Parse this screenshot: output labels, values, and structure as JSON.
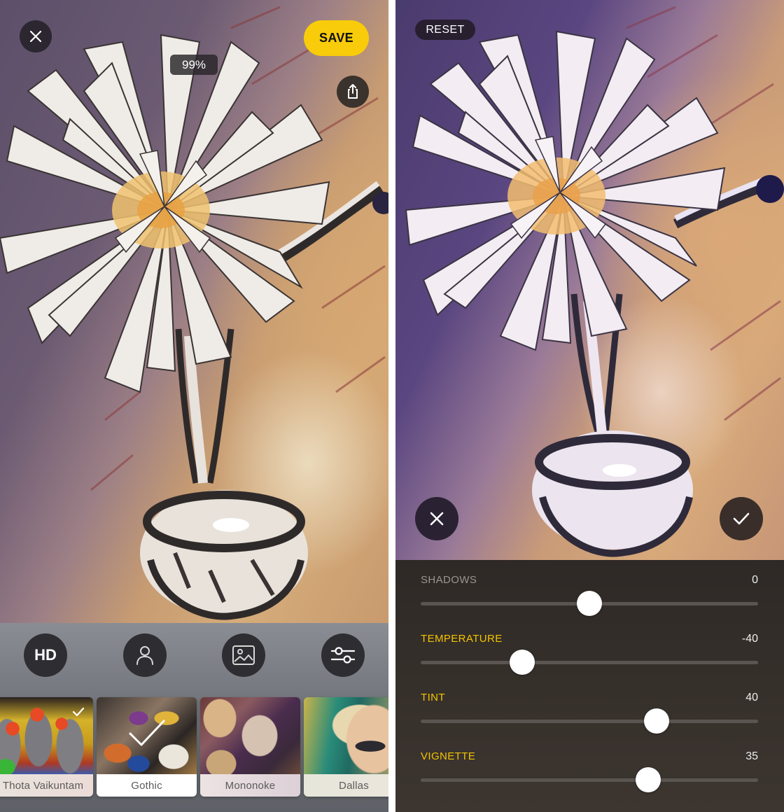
{
  "left_screen": {
    "top_bar": {
      "close_icon": "close-icon",
      "save_label": "SAVE",
      "progress_label": "99%",
      "progress_percent": 99,
      "share_icon": "share-icon"
    },
    "tools": [
      {
        "id": "hd",
        "label": "HD",
        "icon": "hd-text"
      },
      {
        "id": "portrait",
        "label": "",
        "icon": "person-icon"
      },
      {
        "id": "background",
        "label": "",
        "icon": "image-icon"
      },
      {
        "id": "adjust",
        "label": "",
        "icon": "sliders-icon"
      }
    ],
    "filters": [
      {
        "name": "Thota Vaikuntam",
        "selected": false,
        "downloaded": true
      },
      {
        "name": "Gothic",
        "selected": true,
        "downloaded": false
      },
      {
        "name": "Mononoke",
        "selected": false,
        "downloaded": false
      },
      {
        "name": "Dallas",
        "selected": false,
        "downloaded": false
      }
    ]
  },
  "right_screen": {
    "top_bar": {
      "reset_label": "RESET"
    },
    "actions": {
      "cancel_icon": "close-icon",
      "confirm_icon": "checkmark-icon"
    },
    "adjustments": [
      {
        "label": "SHADOWS",
        "value": "0",
        "numeric": 0,
        "min": -100,
        "max": 100,
        "active": false
      },
      {
        "label": "TEMPERATURE",
        "value": "-40",
        "numeric": -40,
        "min": -100,
        "max": 100,
        "active": true
      },
      {
        "label": "TINT",
        "value": "40",
        "numeric": 40,
        "min": -100,
        "max": 100,
        "active": true
      },
      {
        "label": "VIGNETTE",
        "value": "35",
        "numeric": 35,
        "min": -100,
        "max": 100,
        "active": true
      }
    ]
  },
  "colors": {
    "accent_yellow": "#f8cc0a",
    "active_label": "#f5c400",
    "inactive_label": "#9a9590",
    "button_dark": "#2b2630",
    "panel_dark": "#36302b"
  }
}
